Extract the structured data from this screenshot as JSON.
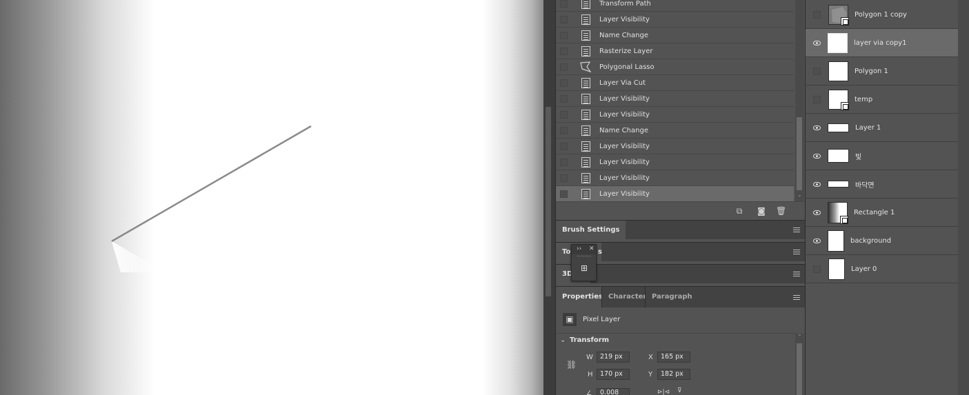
{
  "history": {
    "items": [
      {
        "label": "Transform Path",
        "icon": "document-icon",
        "selected": false
      },
      {
        "label": "Layer Visibility",
        "icon": "document-icon",
        "selected": false
      },
      {
        "label": "Name Change",
        "icon": "document-icon",
        "selected": false
      },
      {
        "label": "Rasterize Layer",
        "icon": "document-icon",
        "selected": false
      },
      {
        "label": "Polygonal Lasso",
        "icon": "polygonal-lasso-icon",
        "selected": false
      },
      {
        "label": "Layer Via Cut",
        "icon": "document-icon",
        "selected": false
      },
      {
        "label": "Layer Visibility",
        "icon": "document-icon",
        "selected": false
      },
      {
        "label": "Layer Visibility",
        "icon": "document-icon",
        "selected": false
      },
      {
        "label": "Name Change",
        "icon": "document-icon",
        "selected": false
      },
      {
        "label": "Layer Visibility",
        "icon": "document-icon",
        "selected": false
      },
      {
        "label": "Layer Visibility",
        "icon": "document-icon",
        "selected": false
      },
      {
        "label": "Layer Visibility",
        "icon": "document-icon",
        "selected": false
      },
      {
        "label": "Layer Visibility",
        "icon": "document-icon",
        "selected": true
      }
    ],
    "footer_icons": [
      "new-document-from-state-icon",
      "camera-icon",
      "trash-icon"
    ]
  },
  "panels": {
    "brush_settings": "Brush Settings",
    "tool_presets_partial": "To",
    "tool_presets_tail": "s",
    "threed": "3D"
  },
  "floating_panel": {
    "collapse_glyph": "››",
    "close_glyph": "✕",
    "icon": "tool-presets-icon"
  },
  "properties": {
    "tabs": [
      "Properties",
      "Character",
      "Paragraph"
    ],
    "layer_type": "Pixel Layer",
    "section": "Transform",
    "w_label": "W",
    "w": "219 px",
    "h_label": "H",
    "h": "170 px",
    "x_label": "X",
    "x": "165 px",
    "y_label": "Y",
    "y": "182 px",
    "angle": "0.008"
  },
  "layers": [
    {
      "name": "Polygon 1 copy",
      "visible": false,
      "selected": false,
      "thumb": "polygon-smart"
    },
    {
      "name": "layer via copy1",
      "visible": true,
      "selected": true,
      "thumb": "checker"
    },
    {
      "name": "Polygon 1",
      "visible": false,
      "selected": false,
      "thumb": "checker-white"
    },
    {
      "name": "temp",
      "visible": false,
      "selected": false,
      "thumb": "white-smart"
    },
    {
      "name": "Layer 1",
      "visible": true,
      "selected": false,
      "thumb": "checker-strip"
    },
    {
      "name": "빛",
      "visible": true,
      "selected": false,
      "thumb": "checker-strip2"
    },
    {
      "name": "바닥면",
      "visible": true,
      "selected": false,
      "thumb": "checker-thin"
    },
    {
      "name": "Rectangle 1",
      "visible": true,
      "selected": false,
      "thumb": "gradient-smart"
    },
    {
      "name": "background",
      "visible": true,
      "selected": false,
      "thumb": "white-tall"
    },
    {
      "name": "Layer 0",
      "visible": false,
      "selected": false,
      "thumb": "white-tall"
    }
  ]
}
